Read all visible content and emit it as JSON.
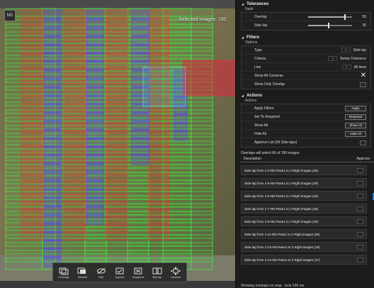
{
  "map": {
    "nd_label": "ND",
    "selected_label": "Selected Images: 190",
    "toolbar": [
      {
        "label": "Coverage",
        "icon": "coverage-icon"
      },
      {
        "label": "Selected",
        "icon": "selected-icon"
      },
      {
        "label": "Hide",
        "icon": "hide-icon"
      },
      {
        "label": "Approve",
        "icon": "approve-icon"
      },
      {
        "label": "Unapprove",
        "icon": "unapprove-icon"
      },
      {
        "label": "Side-lap",
        "icon": "side-lap-icon"
      },
      {
        "label": "Cameras",
        "icon": "cameras-icon"
      }
    ],
    "colors": {
      "nadir_line": "#ff3030",
      "selected": "#5a3cff",
      "overlap": "#3cff3c"
    }
  },
  "tolerances": {
    "title": "Tolerances",
    "group": "Nadir",
    "overlap_label": "Overlap",
    "overlap_value": "55",
    "overlap_fraction": 0.82,
    "sidelap_label": "Side-lap",
    "sidelap_value": "30",
    "sidelap_fraction": 0.45
  },
  "filters": {
    "title": "Filters",
    "group": "Options",
    "type_label": "Type",
    "type_value": "Side-lap",
    "criteria_label": "Criteria",
    "criteria_value": "Below Tolerance",
    "line_label": "Line",
    "line_value": "All lines",
    "show_all_cameras": "Show All Cameras",
    "show_only_overlap": "Show Only Overlap"
  },
  "actions": {
    "title": "Actions",
    "group": "Actions",
    "apply_filters": "Apply Filters",
    "apply_btn": "Apply",
    "set_required": "Set To Required",
    "required_btn": "Required",
    "show_all": "Show All",
    "show_all_btn": "Show All",
    "hide_all": "Hide All",
    "hide_all_btn": "Hide All",
    "approve_list": "Approve List (66 Side-laps)"
  },
  "results": {
    "info": "Overlaps will select 66 of 190 images",
    "col_description": "Description",
    "col_approve": "Approve",
    "rows": [
      "Side-lap from 1-3-ND-Pass1 to 2 Right images (25)",
      "Side-lap from 1-5-ND-Pass1 to 2 Right images (29)",
      "Side-lap from 1-6-ND-Pass1 to 2 Right images (26)",
      "Side-lap from 1-7-ND-Pass1 to 2 Right images (28)",
      "Side-lap from 1-9-ND-Pass1 to 2 Right images (29)",
      "Side-lap from 1-11-ND-Pass1 to 2 Right images (26)",
      "Side-lap from 1-13-ND-Pass1 to 2 Right images (29)",
      "Side-lap from 1-14-ND-Pass1 to 2 Right images (27)"
    ],
    "footer": "Showing overlaps on map - took 536 ms"
  }
}
